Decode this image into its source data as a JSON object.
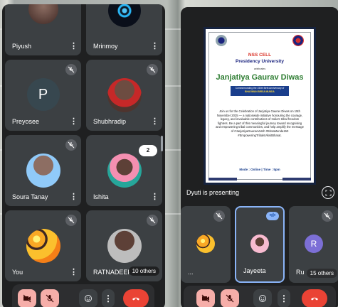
{
  "left_grid": {
    "tiles": [
      {
        "name": "Piyush"
      },
      {
        "name": "Mrinmoy"
      },
      {
        "name": "Preyosee",
        "initial": "P",
        "color": "#37474f"
      },
      {
        "name": "Shubhradip"
      },
      {
        "name": "Soura Tanay"
      },
      {
        "name": "Ishita"
      },
      {
        "name": "You"
      },
      {
        "name": "RATNADEEP"
      }
    ],
    "chat_count": "2",
    "others_label": "10 others"
  },
  "right": {
    "poster": {
      "org": "NSS CELL",
      "university": "Presidency University",
      "celebrates": "celebrates",
      "title": "Janjatiya Gaurav Diwas",
      "band_line1": "Commemorating the 150th Birth Anniversary of",
      "band_line2": "BHAGWAN BIRSA MUNDA",
      "body": "Join us for the Celebration of Janjatiya Gaurav Diwas on 15th November 2025 — a nationwide initiative honouring the courage, legacy, and invaluable contributions of India's tribal freedom fighters. Be a part of this meaningful journey toward recognising and empowering tribal communities, and help amplify the message of #JanjatiyaGauravVarsh #BirsaMunda150 #EmpoweringTribalsViksitBharat.",
      "mode_line": "Mode : Online | Time : 5pm"
    },
    "presenting_label": "Dyuti is presenting",
    "tiles": [
      {
        "name": "..."
      },
      {
        "name": "Jayeeta"
      },
      {
        "name": "Ru",
        "initial": "R",
        "color": "#7c6fd6"
      }
    ],
    "others_label": "15 others"
  },
  "colors": {
    "surface": "#1f2021",
    "tile": "#3c4043",
    "end_call": "#ea4335",
    "muted_ctrl": "#f6aea9",
    "active_speaker_border": "#8ab4f8"
  }
}
